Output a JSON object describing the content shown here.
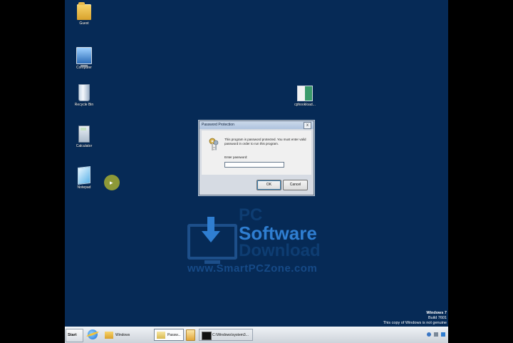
{
  "desktop": {
    "icons": [
      {
        "label": "Guest"
      },
      {
        "label": "Computer"
      },
      {
        "label": "Recycle Bin"
      },
      {
        "label": "Calculator"
      },
      {
        "label": "Notepad"
      },
      {
        "label": "cphookload..."
      }
    ]
  },
  "dialog": {
    "title": "Password Protection",
    "close_glyph": "x",
    "message": "This program is password protected. You must enter valid password in order to run this program.",
    "password_label": "Enter password:",
    "password_value": "",
    "ok_label": "OK",
    "cancel_label": "Cancel"
  },
  "watermark": {
    "line1": "PC",
    "line2": "Software",
    "line3": "Download",
    "url": "www.SmartPCZone.com"
  },
  "windows_info": {
    "edition": "Windows 7",
    "build": "Build 7601",
    "notice": "This copy of Windows is not genuine"
  },
  "taskbar": {
    "start_label": "Start",
    "tasks": [
      {
        "label": "Windows"
      },
      {
        "label": "Passw..."
      },
      {
        "label": "C:\\Windows\\system3..."
      }
    ]
  },
  "colors": {
    "desktop_bg": "#062a56",
    "taskbar_bg": "#dde2e8",
    "dialog_bg": "#f0f0f0"
  }
}
